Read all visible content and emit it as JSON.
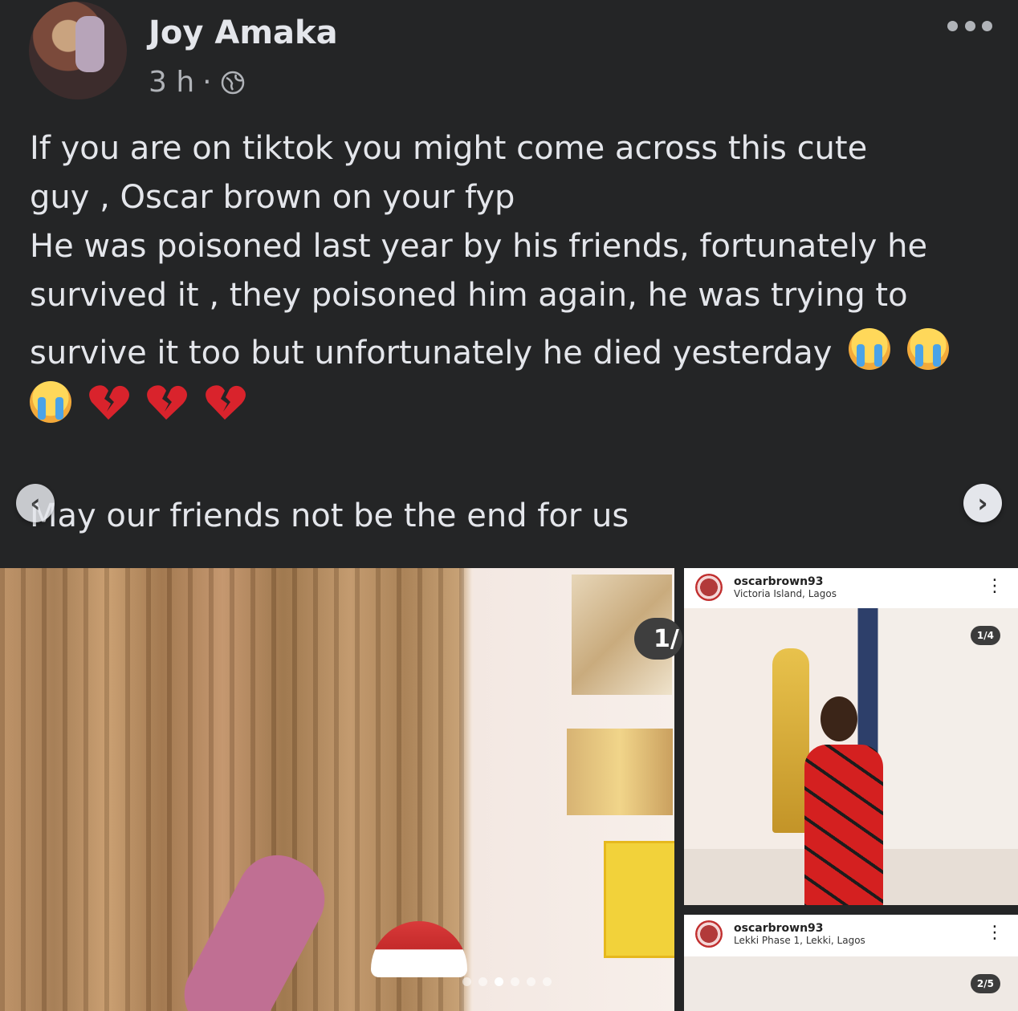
{
  "post": {
    "author": "Joy Amaka",
    "time": "3 h",
    "separator": "·",
    "privacy_icon": "globe-icon",
    "more_icon": "more-options-icon",
    "lines": [
      "If you are on tiktok you might come across this cute",
      "guy , Oscar brown on your fyp",
      "He was poisoned last year by his friends, fortunately he",
      "survived it , they poisoned him again, he was trying to",
      "survive it too but unfortunately he died yesterday"
    ],
    "emoji_line_icons": [
      "loudly-crying-face-icon",
      "broken-heart-icon",
      "broken-heart-icon",
      "broken-heart-icon"
    ],
    "closing": "May our friends not be the end for us"
  },
  "carousel": {
    "prev_icon": "chevron-left-icon",
    "next_icon": "chevron-right-icon",
    "main_counter": "1/",
    "dot_count": 6,
    "active_dot": 2
  },
  "ig_posts": [
    {
      "username": "oscarbrown93",
      "location": "Victoria Island, Lagos",
      "counter": "1/4"
    },
    {
      "username": "oscarbrown93",
      "location": "Lekki Phase 1, Lekki, Lagos",
      "counter": "2/5"
    }
  ],
  "colors": {
    "background": "#242526",
    "text": "#e4e6eb",
    "secondary_text": "#b0b3b8"
  }
}
